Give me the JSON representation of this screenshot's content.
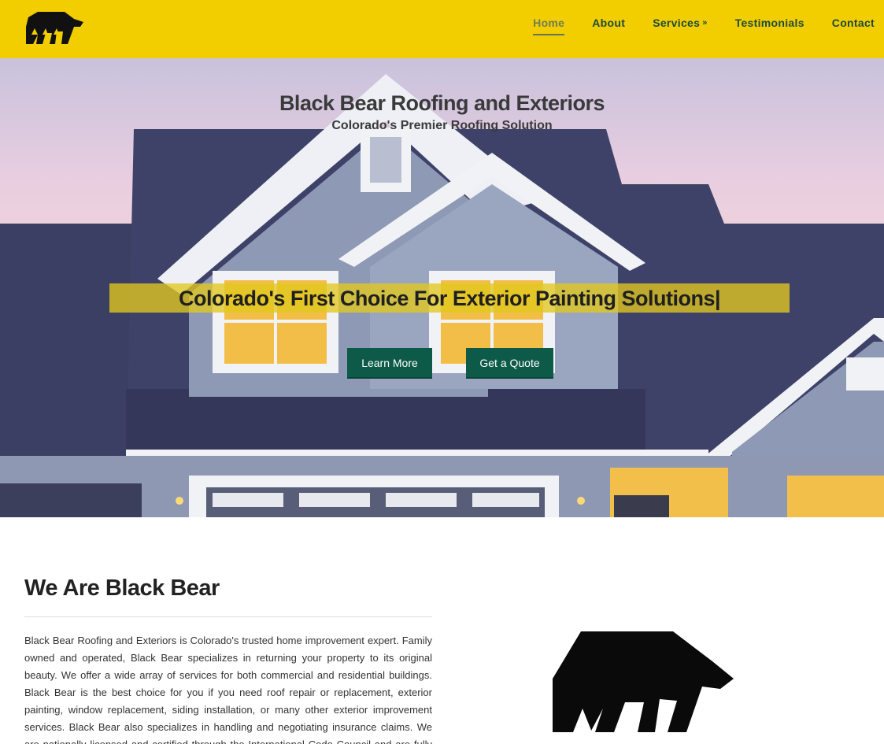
{
  "colors": {
    "header_bg": "#f2cd00",
    "nav_text": "#1d4a3a",
    "nav_active": "#6f7c55",
    "button_bg": "#0d5a48",
    "tagline_bar": "#e2c81e"
  },
  "header": {
    "logo_icon": "bear-logo-icon",
    "nav": [
      {
        "label": "Home",
        "active": true
      },
      {
        "label": "About"
      },
      {
        "label": "Services",
        "icon": "double-chevron-down-icon"
      },
      {
        "label": "Testimonials"
      },
      {
        "label": "Contact"
      }
    ]
  },
  "hero": {
    "title": "Black Bear Roofing and Exteriors",
    "subtitle": "Colorado's Premier Roofing Solution",
    "tagline": "Colorado's First Choice For Exterior Painting Solutions|",
    "buttons": {
      "learn_more": "Learn More",
      "get_quote": "Get a Quote"
    }
  },
  "about": {
    "heading": "We Are Black Bear",
    "body": "Black Bear Roofing and Exteriors is Colorado's trusted home improvement expert. Family owned and operated, Black Bear specializes in returning your property to its original beauty. We offer a wide array of services for both commercial and residential buildings. Black Bear is the best choice for you if you need roof repair or replacement, exterior painting, window replacement, siding installation, or many other exterior improvement services. Black Bear also specializes in handling and negotiating insurance claims. We are nationally licensed and certified through the International Code Council and are fully insured. We would love to work"
  }
}
